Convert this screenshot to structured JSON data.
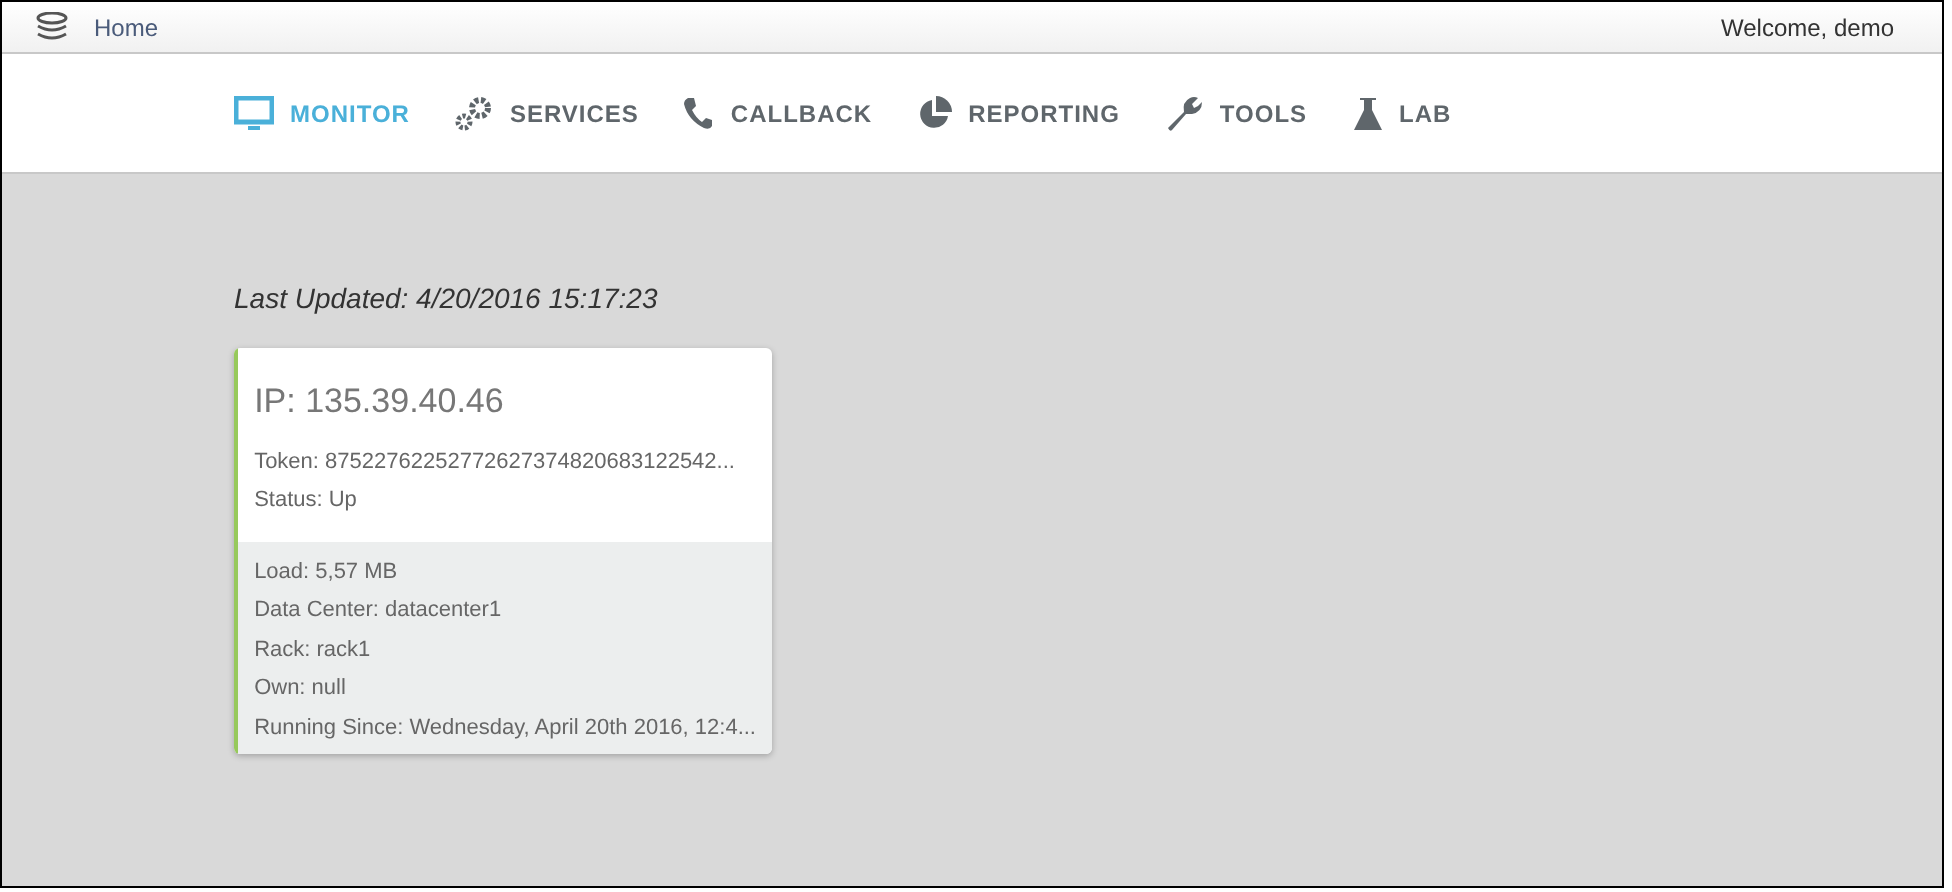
{
  "top_bar": {
    "home": "Home",
    "welcome": "Welcome, demo"
  },
  "nav": [
    {
      "kind": "monitor",
      "label": "MONITOR",
      "selected": true
    },
    {
      "kind": "services",
      "label": "SERVICES",
      "selected": false
    },
    {
      "kind": "callback",
      "label": "CALLBACK",
      "selected": false
    },
    {
      "kind": "reporting",
      "label": "REPORTING",
      "selected": false
    },
    {
      "kind": "tools",
      "label": "TOOLS",
      "selected": false
    },
    {
      "kind": "lab",
      "label": "LAB",
      "selected": false
    }
  ],
  "last_updated": "Last Updated: 4/20/2016 15:17:23",
  "nodes": [
    {
      "color": "#97c95c",
      "ip": "IP: 135.39.40.46",
      "token": "Token: 87522762252772627374820683122542...",
      "status": "Status: Up",
      "details": [
        "Load: 5,57 MB",
        "Data Center: datacenter1",
        "Rack: rack1",
        "Own: null",
        "Running Since: Wednesday, April 20th 2016, 12:4..."
      ]
    }
  ]
}
